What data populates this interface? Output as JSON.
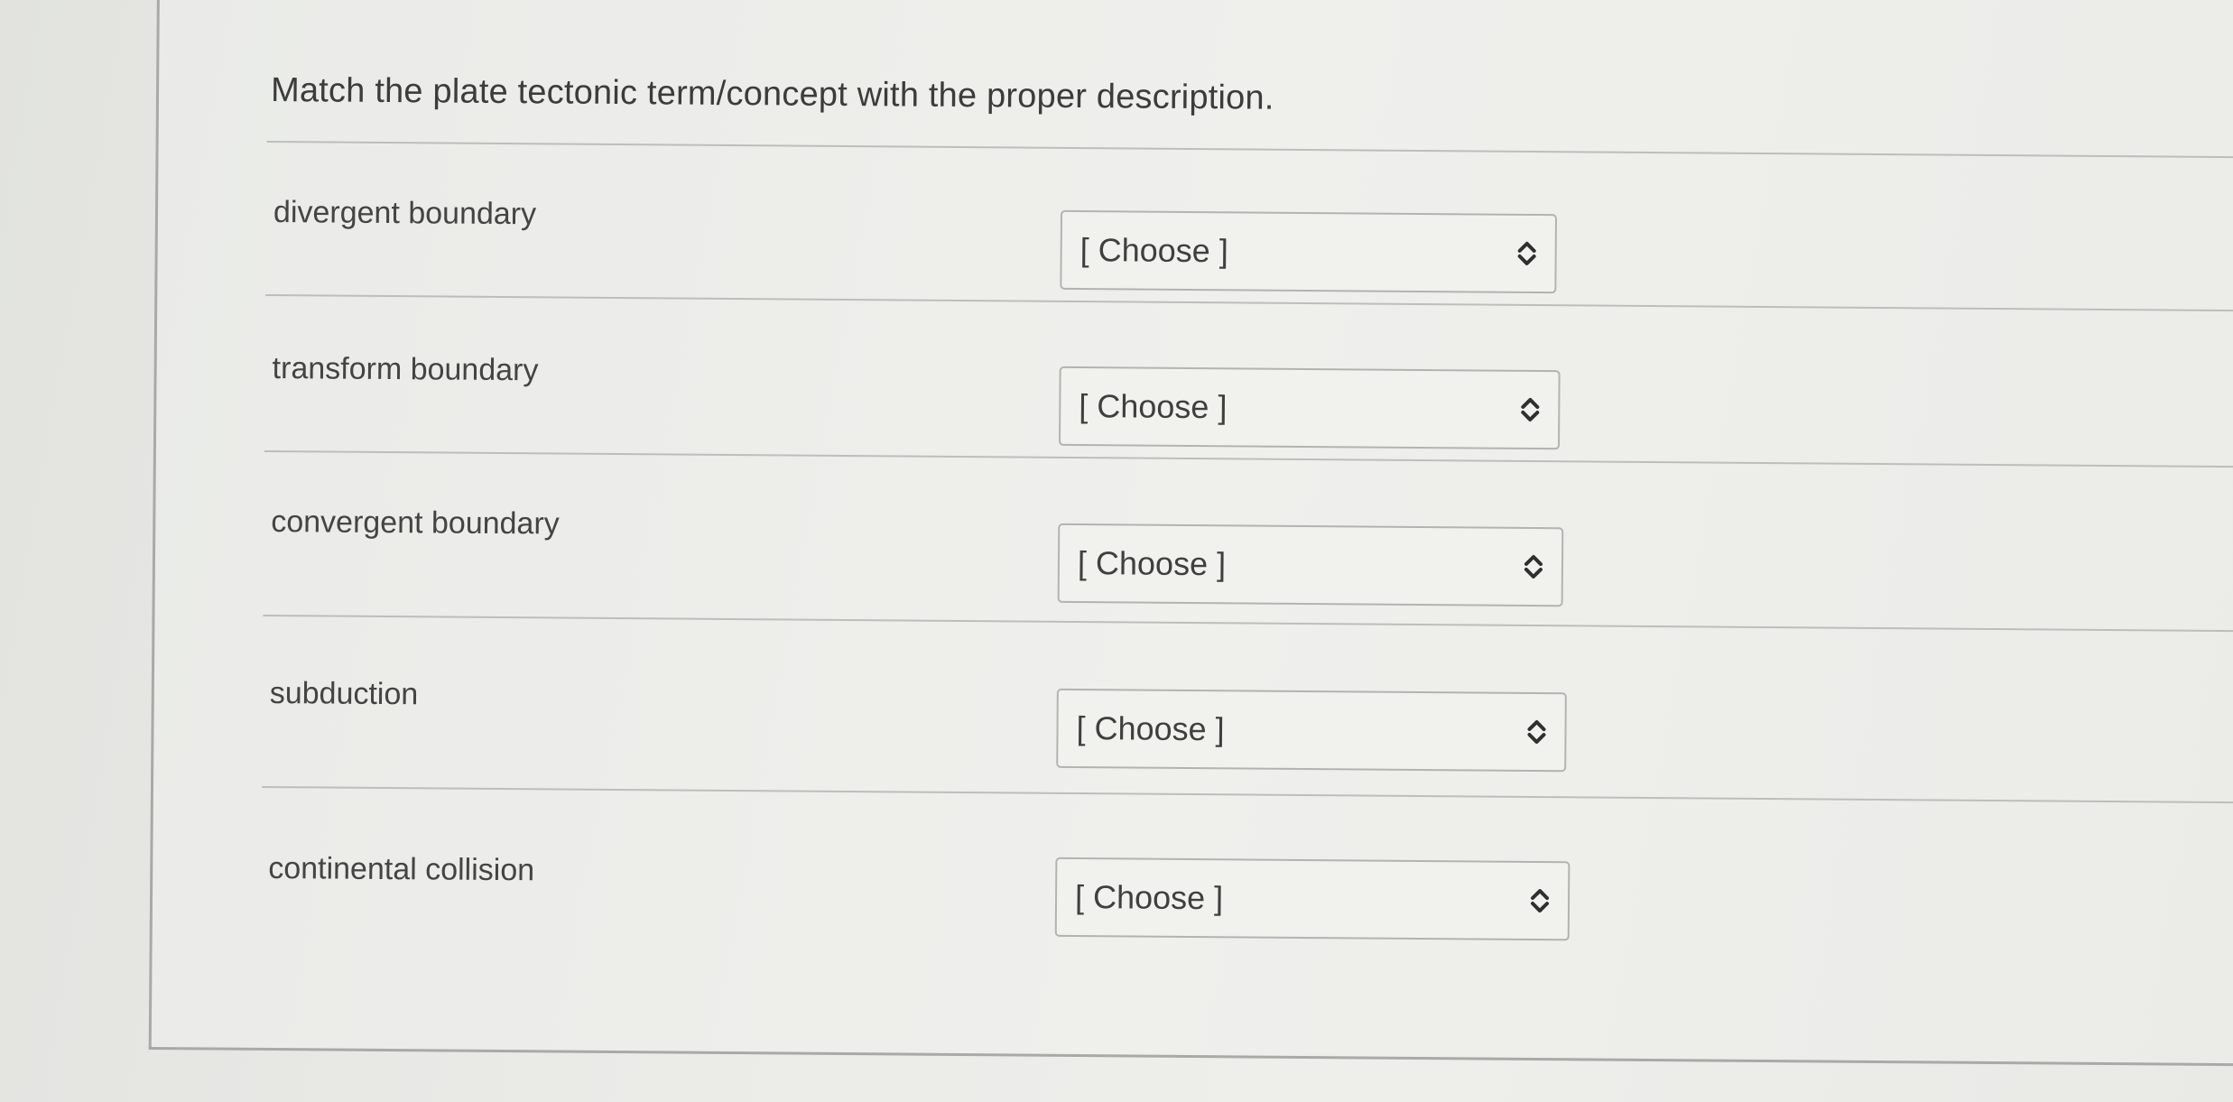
{
  "question": {
    "text": "Match the plate tectonic term/concept with the proper description."
  },
  "rows": [
    {
      "term": "divergent boundary",
      "selected": "[ Choose ]"
    },
    {
      "term": "transform boundary",
      "selected": "[ Choose ]"
    },
    {
      "term": "convergent boundary",
      "selected": "[ Choose ]"
    },
    {
      "term": "subduction",
      "selected": "[ Choose ]"
    },
    {
      "term": "continental collision",
      "selected": "[ Choose ]"
    }
  ],
  "icons": {
    "select_indicator": "chevron-up-down-icon"
  }
}
